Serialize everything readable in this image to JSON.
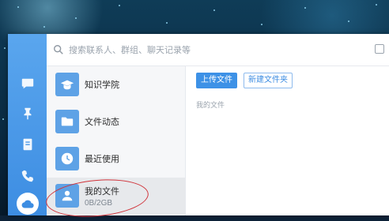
{
  "search": {
    "placeholder": "搜索联系人、群组、聊天记录等"
  },
  "sidebar": {
    "items": [
      {
        "label": "知识学院",
        "icon": "graduation-cap-icon"
      },
      {
        "label": "文件动态",
        "icon": "folder-icon"
      },
      {
        "label": "最近使用",
        "icon": "clock-icon"
      },
      {
        "label": "我的文件",
        "sub": "0B/2GB",
        "icon": "user-icon",
        "selected": true
      }
    ]
  },
  "rail": {
    "icons": [
      "chat-icon",
      "pin-icon",
      "notebook-icon",
      "phone-icon",
      "cloud-icon"
    ]
  },
  "toolbar": {
    "upload_label": "上传文件",
    "new_folder_label": "新建文件夹"
  },
  "main": {
    "breadcrumb": "我的文件"
  },
  "colors": {
    "accent": "#3d8de2",
    "annotation": "#d0333a"
  }
}
